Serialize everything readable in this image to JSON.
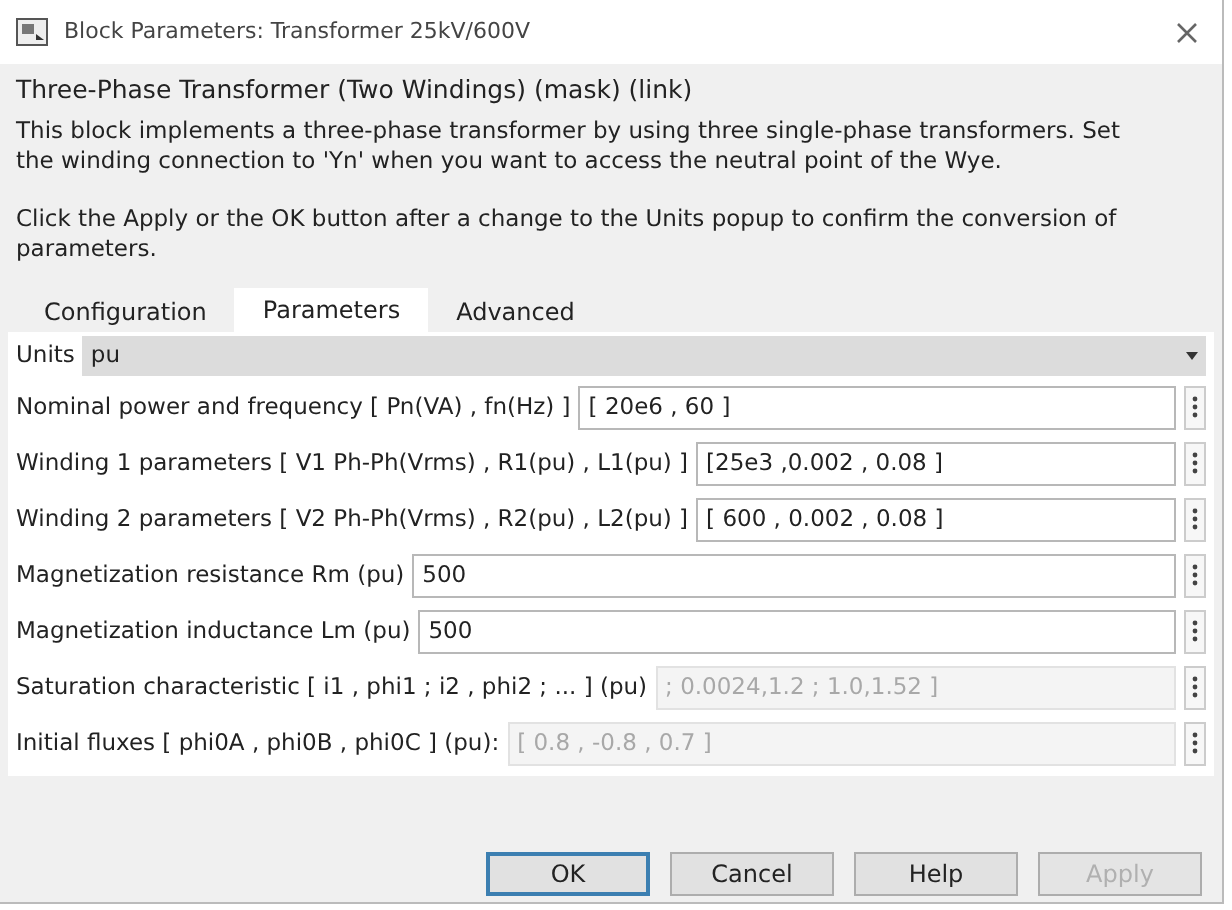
{
  "window": {
    "title": "Block Parameters: Transformer 25kV/600V"
  },
  "mask_title": "Three-Phase Transformer (Two Windings) (mask) (link)",
  "description": [
    "This block implements a three-phase transformer by using three single-phase transformers. Set the winding connection to 'Yn'  when you want to access the neutral point of the Wye.",
    "Click the Apply or the OK button after a change to the Units popup to confirm the conversion of parameters."
  ],
  "tabs": [
    {
      "label": "Configuration",
      "selected": false
    },
    {
      "label": "Parameters",
      "selected": true
    },
    {
      "label": "Advanced",
      "selected": false
    }
  ],
  "units": {
    "label": "Units",
    "value": "pu"
  },
  "parameters": [
    {
      "label": "Nominal power and frequency  [ Pn(VA) , fn(Hz) ]",
      "value": "[ 20e6 , 60 ]",
      "disabled": false
    },
    {
      "label": "Winding 1 parameters [ V1 Ph-Ph(Vrms) , R1(pu) , L1(pu) ]",
      "value": "[25e3 ,0.002 , 0.08 ]",
      "disabled": false
    },
    {
      "label": "Winding 2 parameters [ V2 Ph-Ph(Vrms) , R2(pu) , L2(pu) ]",
      "value": "[ 600 , 0.002 , 0.08 ]",
      "disabled": false
    },
    {
      "label": "Magnetization resistance  Rm (pu)",
      "value": "500",
      "disabled": false
    },
    {
      "label": "Magnetization inductance  Lm (pu)",
      "value": "500",
      "disabled": false
    },
    {
      "label": "Saturation characteristic [ i1 ,  phi1 ;  i2 , phi2 ; ... ] (pu)",
      "value": "; 0.0024,1.2 ; 1.0,1.52 ]",
      "disabled": true
    },
    {
      "label": "Initial fluxes [ phi0A , phi0B , phi0C ] (pu):",
      "value": "[ 0.8 , -0.8 , 0.7 ]",
      "disabled": true
    }
  ],
  "buttons": [
    {
      "label": "OK",
      "default": true,
      "disabled": false
    },
    {
      "label": "Cancel",
      "default": false,
      "disabled": false
    },
    {
      "label": "Help",
      "default": false,
      "disabled": false
    },
    {
      "label": "Apply",
      "default": false,
      "disabled": true
    }
  ]
}
